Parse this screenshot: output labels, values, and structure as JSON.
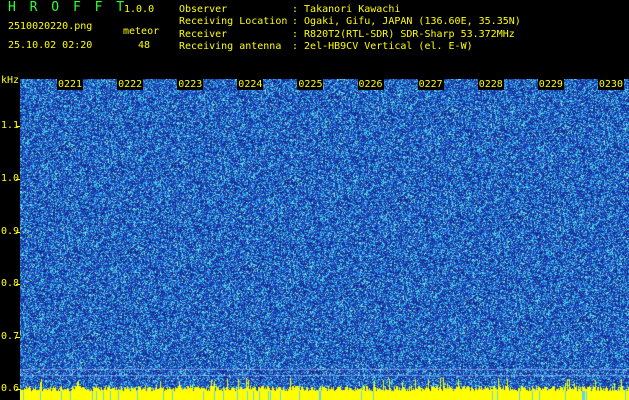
{
  "header": {
    "app_name": "H R O F F T",
    "version": "1.0.0",
    "filename": "2510020220.png",
    "datetime": "25.10.02 02:20",
    "category_label": "meteor",
    "category_count": "48"
  },
  "info": {
    "observer_label": "Observer",
    "observer_value": ": Takanori Kawachi",
    "location_label": "Receiving Location",
    "location_value": ": Ogaki, Gifu, JAPAN (136.60E, 35.35N)",
    "receiver_label": "Receiver",
    "receiver_value": ": R820T2(RTL-SDR) SDR-Sharp 53.372MHz",
    "antenna_label": "Receiving antenna",
    "antenna_value": ": 2el-HB9CV Vertical (el. E-W)"
  },
  "spectrogram": {
    "unit_label": "kHz",
    "time_ticks": [
      "0221",
      "0222",
      "0223",
      "0224",
      "0225",
      "0226",
      "0227",
      "0228",
      "0229",
      "0230"
    ],
    "freq_ticks": [
      "1.1",
      "1.0",
      "0.9",
      "0.8",
      "0.7",
      "0.6"
    ],
    "freq_range_khz": [
      0.58,
      1.19
    ],
    "colors": {
      "background": "#1a3a9c",
      "noise": "#3ad2e8",
      "baseline": "#ffff00"
    }
  }
}
